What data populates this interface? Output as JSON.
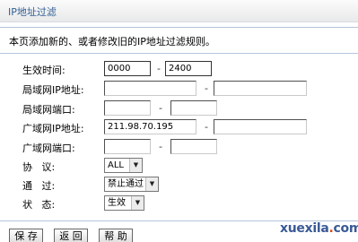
{
  "panel": {
    "title": "IP地址过滤",
    "description": "本页添加新的、或者修改旧的IP地址过滤规则。"
  },
  "form": {
    "effective_time": {
      "label": "生效时间:",
      "start_value": "0000",
      "end_value": "2400",
      "separator": "-"
    },
    "lan_ip": {
      "label": "局域网IP地址:",
      "start_value": "",
      "end_value": "",
      "separator": "-"
    },
    "lan_port": {
      "label": "局域网端口:",
      "start_value": "",
      "end_value": "",
      "separator": "-"
    },
    "wan_ip": {
      "label": "广域网IP地址:",
      "start_value": "211.98.70.195",
      "end_value": "",
      "separator": "-"
    },
    "wan_port": {
      "label": "广域网端口:",
      "start_value": "",
      "end_value": "",
      "separator": "-"
    },
    "protocol": {
      "label": "协   议:",
      "selected": "ALL"
    },
    "pass": {
      "label": "通   过:",
      "selected": "禁止通过"
    },
    "status": {
      "label": "状   态:",
      "selected": "生效"
    }
  },
  "buttons": {
    "save": "保 存",
    "back": "返 回",
    "help": "帮 助"
  },
  "watermark": {
    "before": "xuexila",
    "dot": ".",
    "after": "com"
  },
  "icons": {
    "dropdown": "chevron-down-icon"
  }
}
